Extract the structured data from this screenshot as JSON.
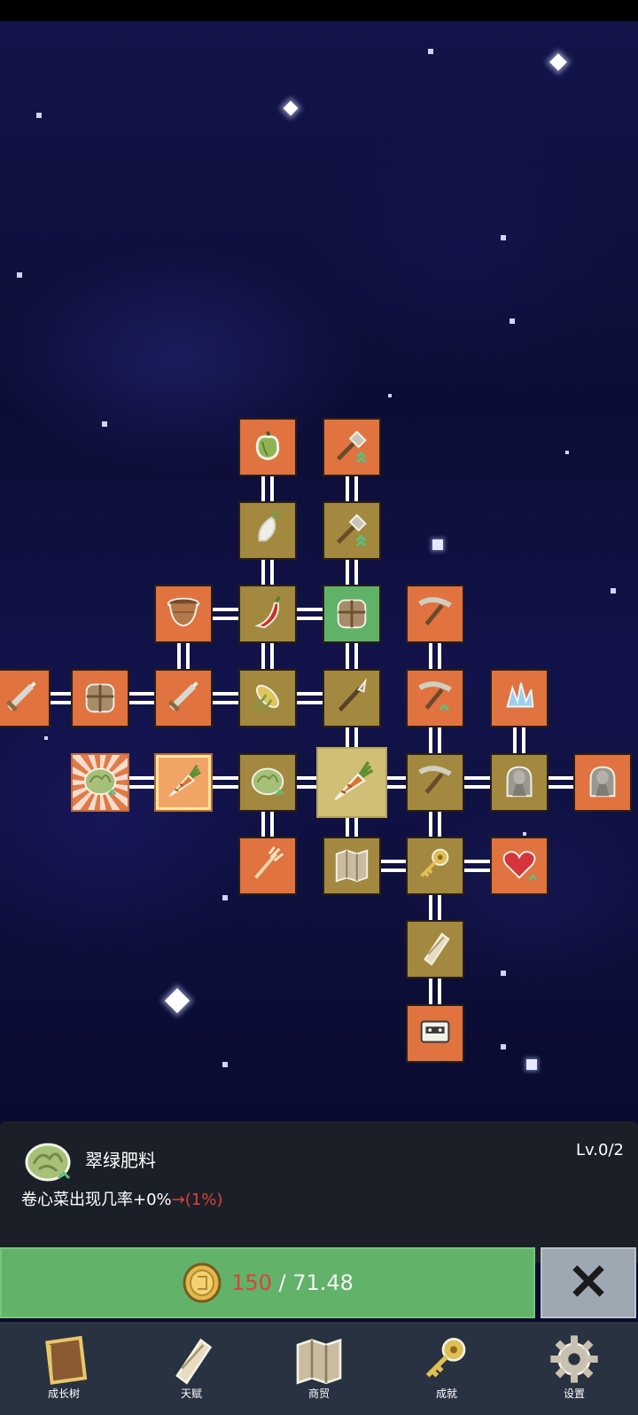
{
  "tree": {
    "nodes": [
      {
        "id": "pepper",
        "icon": "bell-pepper-icon",
        "style": "orange"
      },
      {
        "id": "shovel-top",
        "icon": "shovel-upgrade-icon",
        "style": "orange"
      },
      {
        "id": "radish",
        "icon": "radish-icon",
        "style": "olive"
      },
      {
        "id": "shovel",
        "icon": "shovel-upgrade-icon",
        "style": "olive"
      },
      {
        "id": "pot",
        "icon": "clay-pot-icon",
        "style": "orange"
      },
      {
        "id": "chili",
        "icon": "chili-icon",
        "style": "olive"
      },
      {
        "id": "backpack-green",
        "icon": "backpack-icon",
        "style": "green"
      },
      {
        "id": "pickaxe-top",
        "icon": "pickaxe-icon",
        "style": "orange"
      },
      {
        "id": "sword-edge",
        "icon": "sword-icon",
        "style": "orange"
      },
      {
        "id": "backpack",
        "icon": "backpack-icon",
        "style": "orange"
      },
      {
        "id": "sword",
        "icon": "sword-icon",
        "style": "orange"
      },
      {
        "id": "corn",
        "icon": "corn-icon",
        "style": "olive"
      },
      {
        "id": "spear",
        "icon": "spear-icon",
        "style": "olive"
      },
      {
        "id": "pickaxe-up",
        "icon": "pickaxe-upgrade-icon",
        "style": "orange"
      },
      {
        "id": "crystal",
        "icon": "crystal-icon",
        "style": "orange"
      },
      {
        "id": "cabbage-rays",
        "icon": "cabbage-icon",
        "style": "rays"
      },
      {
        "id": "carrot-glow",
        "icon": "carrot-icon",
        "style": "glow"
      },
      {
        "id": "cabbage",
        "icon": "cabbage-icon",
        "style": "olive"
      },
      {
        "id": "carrot-center",
        "icon": "carrot-icon",
        "style": "center"
      },
      {
        "id": "pickaxe",
        "icon": "pickaxe-icon",
        "style": "olive"
      },
      {
        "id": "statue",
        "icon": "statue-icon",
        "style": "olive"
      },
      {
        "id": "statue-edge",
        "icon": "statue-icon",
        "style": "orange"
      },
      {
        "id": "wheat",
        "icon": "wheat-icon",
        "style": "orange"
      },
      {
        "id": "map",
        "icon": "map-icon",
        "style": "olive"
      },
      {
        "id": "key",
        "icon": "key-icon",
        "style": "olive"
      },
      {
        "id": "heart",
        "icon": "heart-icon",
        "style": "orange"
      },
      {
        "id": "scroll",
        "icon": "scroll-icon",
        "style": "olive"
      },
      {
        "id": "cassette",
        "icon": "cassette-icon",
        "style": "orange"
      }
    ]
  },
  "info": {
    "icon": "cabbage-icon",
    "title": "翠绿肥料",
    "level": "Lv.0/2",
    "desc_main": "卷心菜出现几率+0%",
    "desc_arrow": "→",
    "desc_next": "(1%)"
  },
  "upgrade": {
    "cost_need": "150",
    "separator": " / ",
    "cost_have": "71.48"
  },
  "nav": [
    {
      "label": "成长树",
      "icon": "book-icon"
    },
    {
      "label": "天赋",
      "icon": "scroll-icon"
    },
    {
      "label": "商贸",
      "icon": "map-icon"
    },
    {
      "label": "成就",
      "icon": "key-icon"
    },
    {
      "label": "设置",
      "icon": "gear-icon"
    }
  ],
  "colors": {
    "orange_node": "#e07340",
    "olive_node": "#a38840",
    "green_node": "#60b269",
    "upgrade_button": "#62b26a",
    "cost_red": "#d9443b",
    "panel_bg": "#1b1f27",
    "nav_bg": "#283240"
  }
}
